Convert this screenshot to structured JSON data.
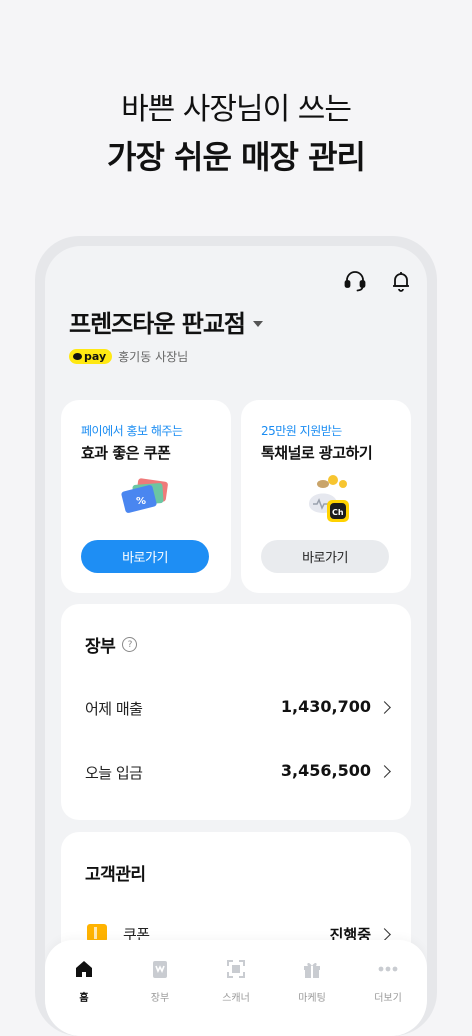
{
  "hero": {
    "line1": "바쁜 사장님이 쓰는",
    "line2": "가장 쉬운 매장 관리"
  },
  "header": {
    "store_name": "프렌즈타운 판교점",
    "pay_badge": "pay",
    "owner": "홍기동 사장님",
    "icons": [
      "headset-icon",
      "bell-icon"
    ]
  },
  "promos": [
    {
      "subtitle": "페이에서 홍보 해주는",
      "title": "효과 좋은 쿠폰",
      "button": "바로가기",
      "icon": "coupon-cards-icon",
      "accent": "#1e8ef4"
    },
    {
      "subtitle": "25만원 지원받는",
      "title": "톡채널로 광고하기",
      "button": "바로가기",
      "icon": "money-bag-channel-icon",
      "accent": "#1a8cf2"
    }
  ],
  "ledger": {
    "title": "장부",
    "rows": [
      {
        "label": "어제 매출",
        "value": "1,430,700"
      },
      {
        "label": "오늘 입금",
        "value": "3,456,500"
      }
    ]
  },
  "customer": {
    "title": "고객관리",
    "rows": [
      {
        "label": "쿠폰",
        "value": "진행중"
      }
    ]
  },
  "tabs": [
    {
      "label": "홈",
      "icon": "home-icon",
      "active": true
    },
    {
      "label": "장부",
      "icon": "ledger-icon",
      "active": false
    },
    {
      "label": "스캐너",
      "icon": "scanner-icon",
      "active": false
    },
    {
      "label": "마케팅",
      "icon": "gift-icon",
      "active": false
    },
    {
      "label": "더보기",
      "icon": "more-icon",
      "active": false
    }
  ]
}
